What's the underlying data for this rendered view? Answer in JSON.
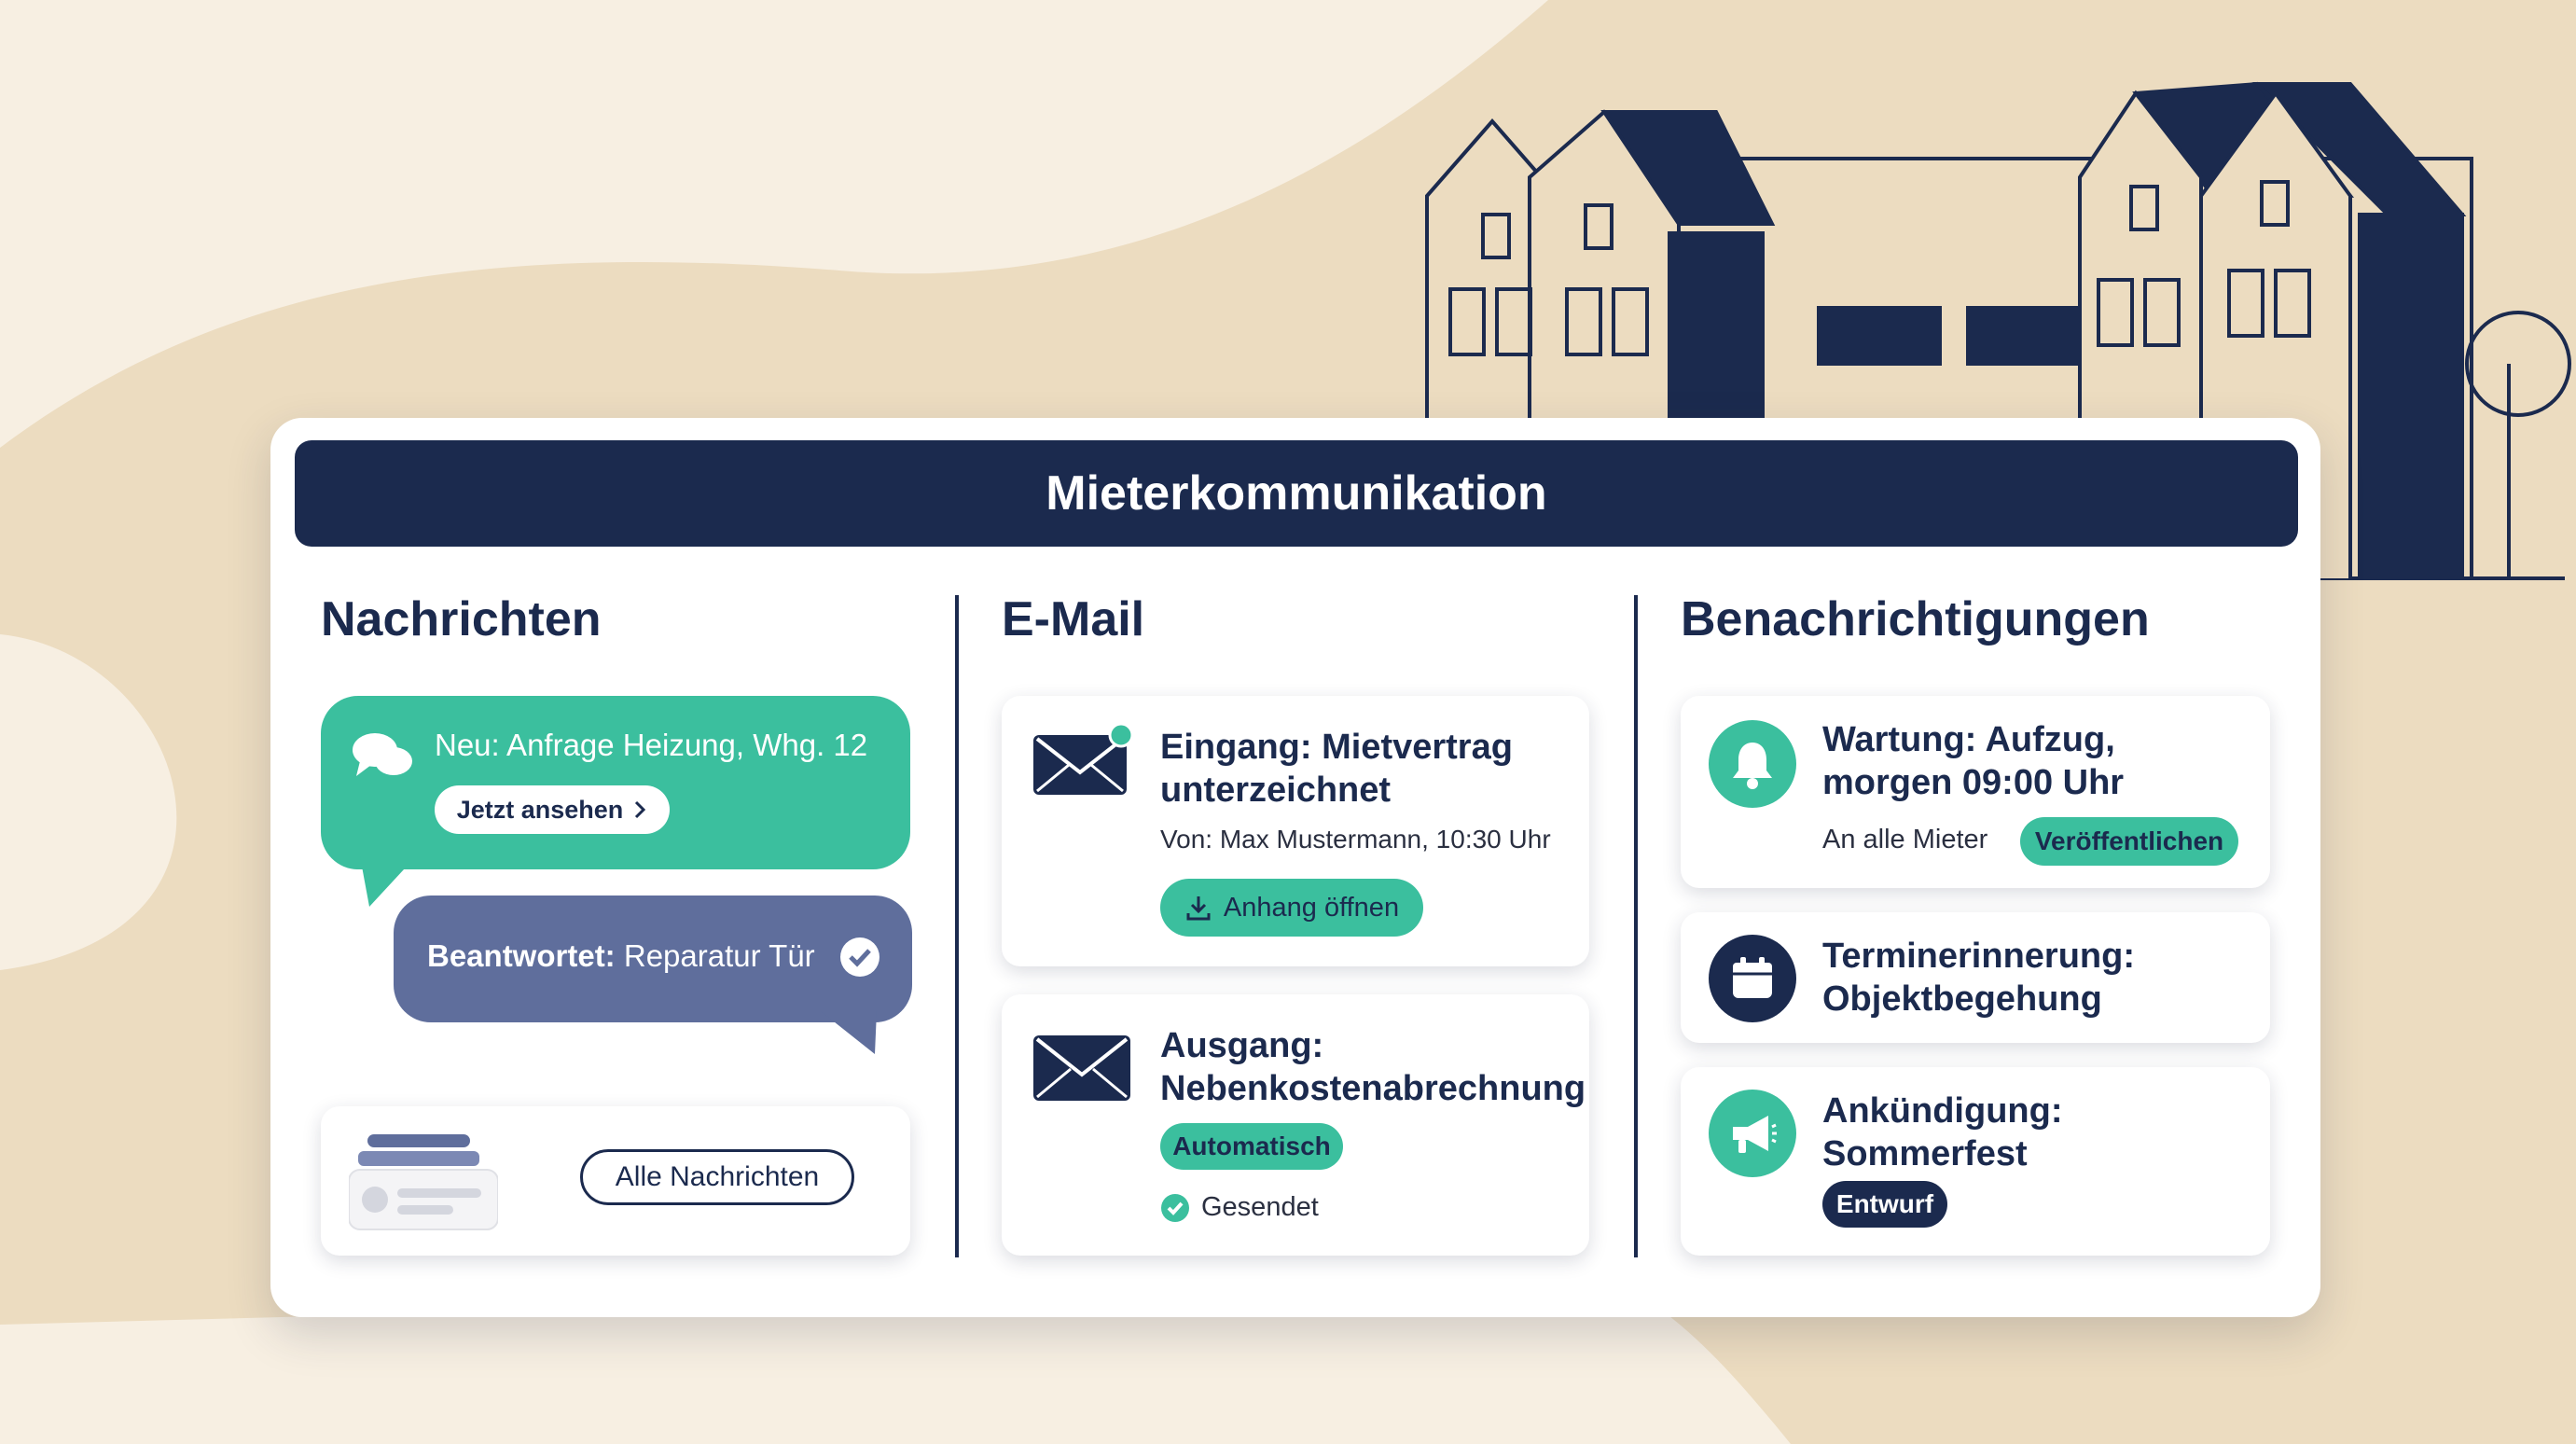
{
  "title": "Mieterkommunikation",
  "columns": {
    "messages": {
      "title": "Nachrichten",
      "new_message": "Neu: Anfrage Heizung, Whg. 12",
      "view_button": "Jetzt ansehen",
      "answered_prefix": "Beantwortet:",
      "answered_text": " Reparatur Tür",
      "all_button": "Alle Nachrichten"
    },
    "email": {
      "title": "E-Mail",
      "inbox_title_1": "Eingang: Mietvertrag",
      "inbox_title_2": "unterzeichnet",
      "inbox_from": "Von: Max Mustermann, 10:30 Uhr",
      "attachment_button": "Anhang öffnen",
      "outbox_title_1": "Ausgang:",
      "outbox_title_2": "Nebenkostenabrechnung",
      "automatic_badge": "Automatisch",
      "sent_status": "Gesendet"
    },
    "notifications": {
      "title": "Benachrichtigungen",
      "maintenance_title_1": "Wartung: Aufzug,",
      "maintenance_title_2": "morgen 09:00 Uhr",
      "maintenance_audience": "An alle Mieter",
      "publish_button": "Veröffentlichen",
      "reminder_title_1": "Terminerinnerung:",
      "reminder_title_2": "Objektbegehung",
      "announcement_title_1": "Ankündigung:",
      "announcement_title_2": "Sommerfest",
      "draft_badge": "Entwurf"
    }
  },
  "colors": {
    "navy": "#1b2a4e",
    "green": "#3bbf9e",
    "slate_blue": "#5f6e9c",
    "beige": "#ecdcc0"
  }
}
